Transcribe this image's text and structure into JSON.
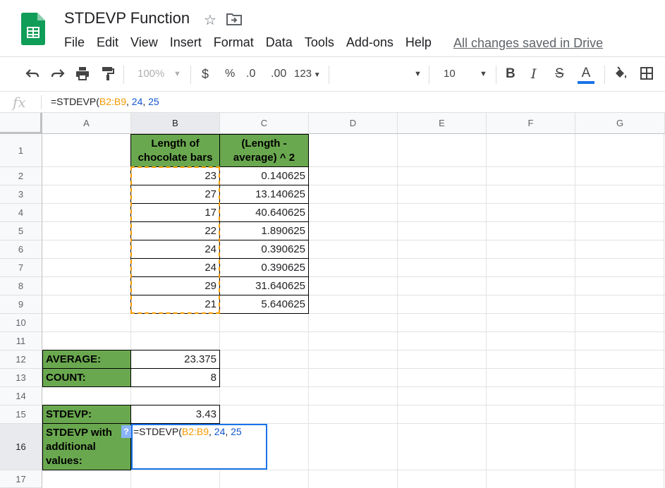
{
  "app": {
    "title": "STDEVP Function",
    "menu": [
      "File",
      "Edit",
      "View",
      "Insert",
      "Format",
      "Data",
      "Tools",
      "Add-ons",
      "Help"
    ],
    "saved_status": "All changes saved in Drive"
  },
  "toolbar": {
    "zoom": "100%",
    "currency": "$",
    "percent": "%",
    "dec_decrease": ".0",
    "dec_increase": ".00",
    "more_formats": "123",
    "font_size": "10",
    "bold": "B",
    "italic": "I",
    "strike": "S",
    "text_color": "A",
    "text_color_value": "#1a73e8"
  },
  "formula_bar": {
    "fx": "fx",
    "prefix": "=STDEVP(",
    "range": "B2:B9",
    "sep1": ", ",
    "arg1": "24",
    "sep2": ", ",
    "arg2": "25"
  },
  "columns": [
    "A",
    "B",
    "C",
    "D",
    "E",
    "F",
    "G"
  ],
  "rows": [
    "1",
    "2",
    "3",
    "4",
    "5",
    "6",
    "7",
    "8",
    "9",
    "10",
    "11",
    "12",
    "13",
    "14",
    "15",
    "16",
    "17"
  ],
  "sheet": {
    "b1": "Length of chocolate bars",
    "c1": "(Length - average) ^ 2",
    "lengths": [
      "23",
      "27",
      "17",
      "22",
      "24",
      "24",
      "29",
      "21"
    ],
    "squares": [
      "0.140625",
      "13.140625",
      "40.640625",
      "1.890625",
      "0.390625",
      "0.390625",
      "31.640625",
      "5.640625"
    ],
    "average_label": "AVERAGE:",
    "average_value": "23.375",
    "count_label": "COUNT:",
    "count_value": "8",
    "stdevp_label": "STDEVP:",
    "stdevp_value": "3.43",
    "stdevp_extra_label": "STDEVP with additional values:",
    "help_badge": "?"
  },
  "colors": {
    "green_fill": "#6aa84f",
    "range_highlight": "#f29900",
    "active_cell_border": "#1a73e8",
    "formula_number": "#1155cc"
  }
}
